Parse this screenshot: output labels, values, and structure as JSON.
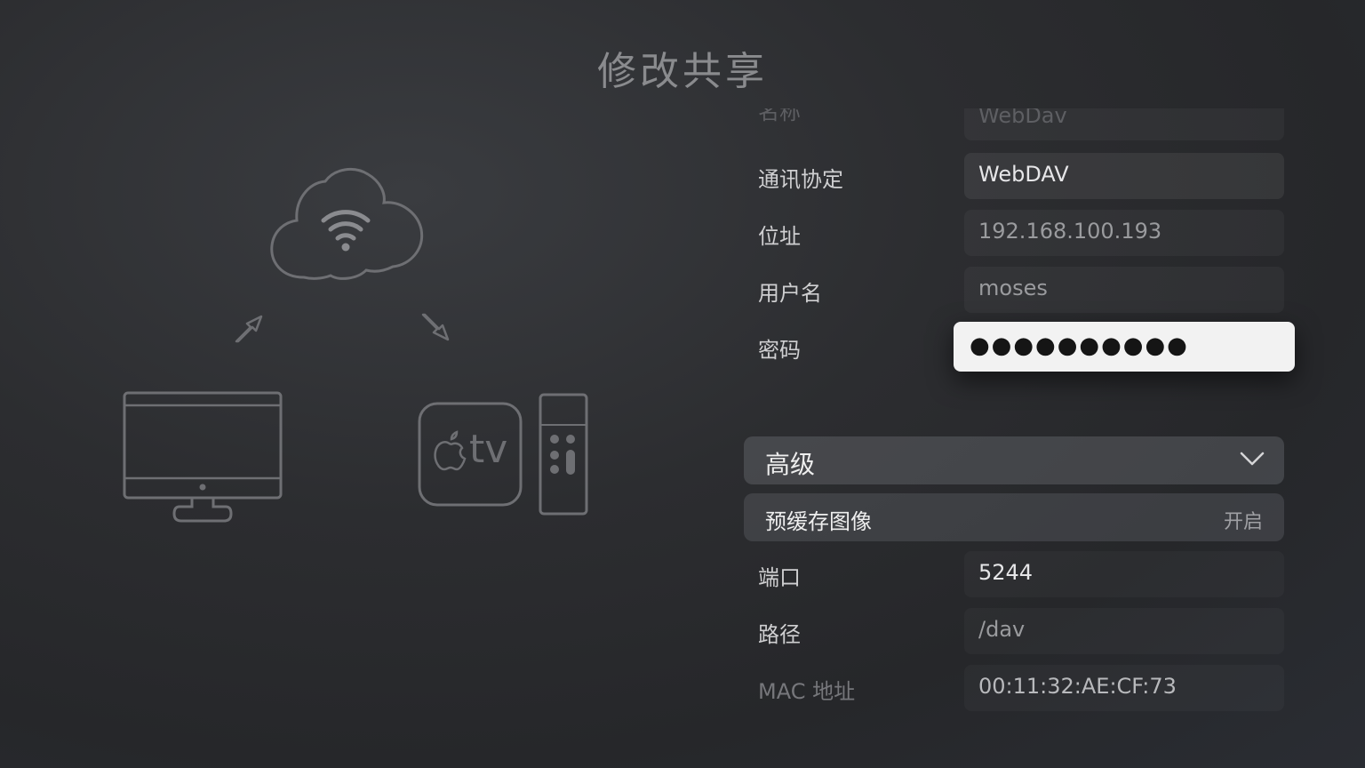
{
  "page": {
    "title": "修改共享"
  },
  "illustration": {
    "tv_text": "tv"
  },
  "form": {
    "name": {
      "label": "名称",
      "value": "WebDav"
    },
    "protocol": {
      "label": "通讯协定",
      "value": "WebDAV"
    },
    "address": {
      "label": "位址",
      "value": "192.168.100.193"
    },
    "username": {
      "label": "用户名",
      "value": "moses"
    },
    "password": {
      "label": "密码",
      "value": "●●●●●●●●●●"
    },
    "advanced": {
      "label": "高级"
    },
    "precache": {
      "label": "预缓存图像",
      "value": "开启"
    },
    "port": {
      "label": "端口",
      "value": "5244"
    },
    "path": {
      "label": "路径",
      "value": "/dav"
    },
    "mac": {
      "label": "MAC 地址",
      "value": "00:11:32:AE:CF:73"
    }
  },
  "icons": [
    "cloud-wifi-icon",
    "arrow-up-left-icon",
    "arrow-down-right-icon",
    "monitor-icon",
    "apple-tv-icon",
    "remote-icon",
    "chevron-down-icon"
  ]
}
